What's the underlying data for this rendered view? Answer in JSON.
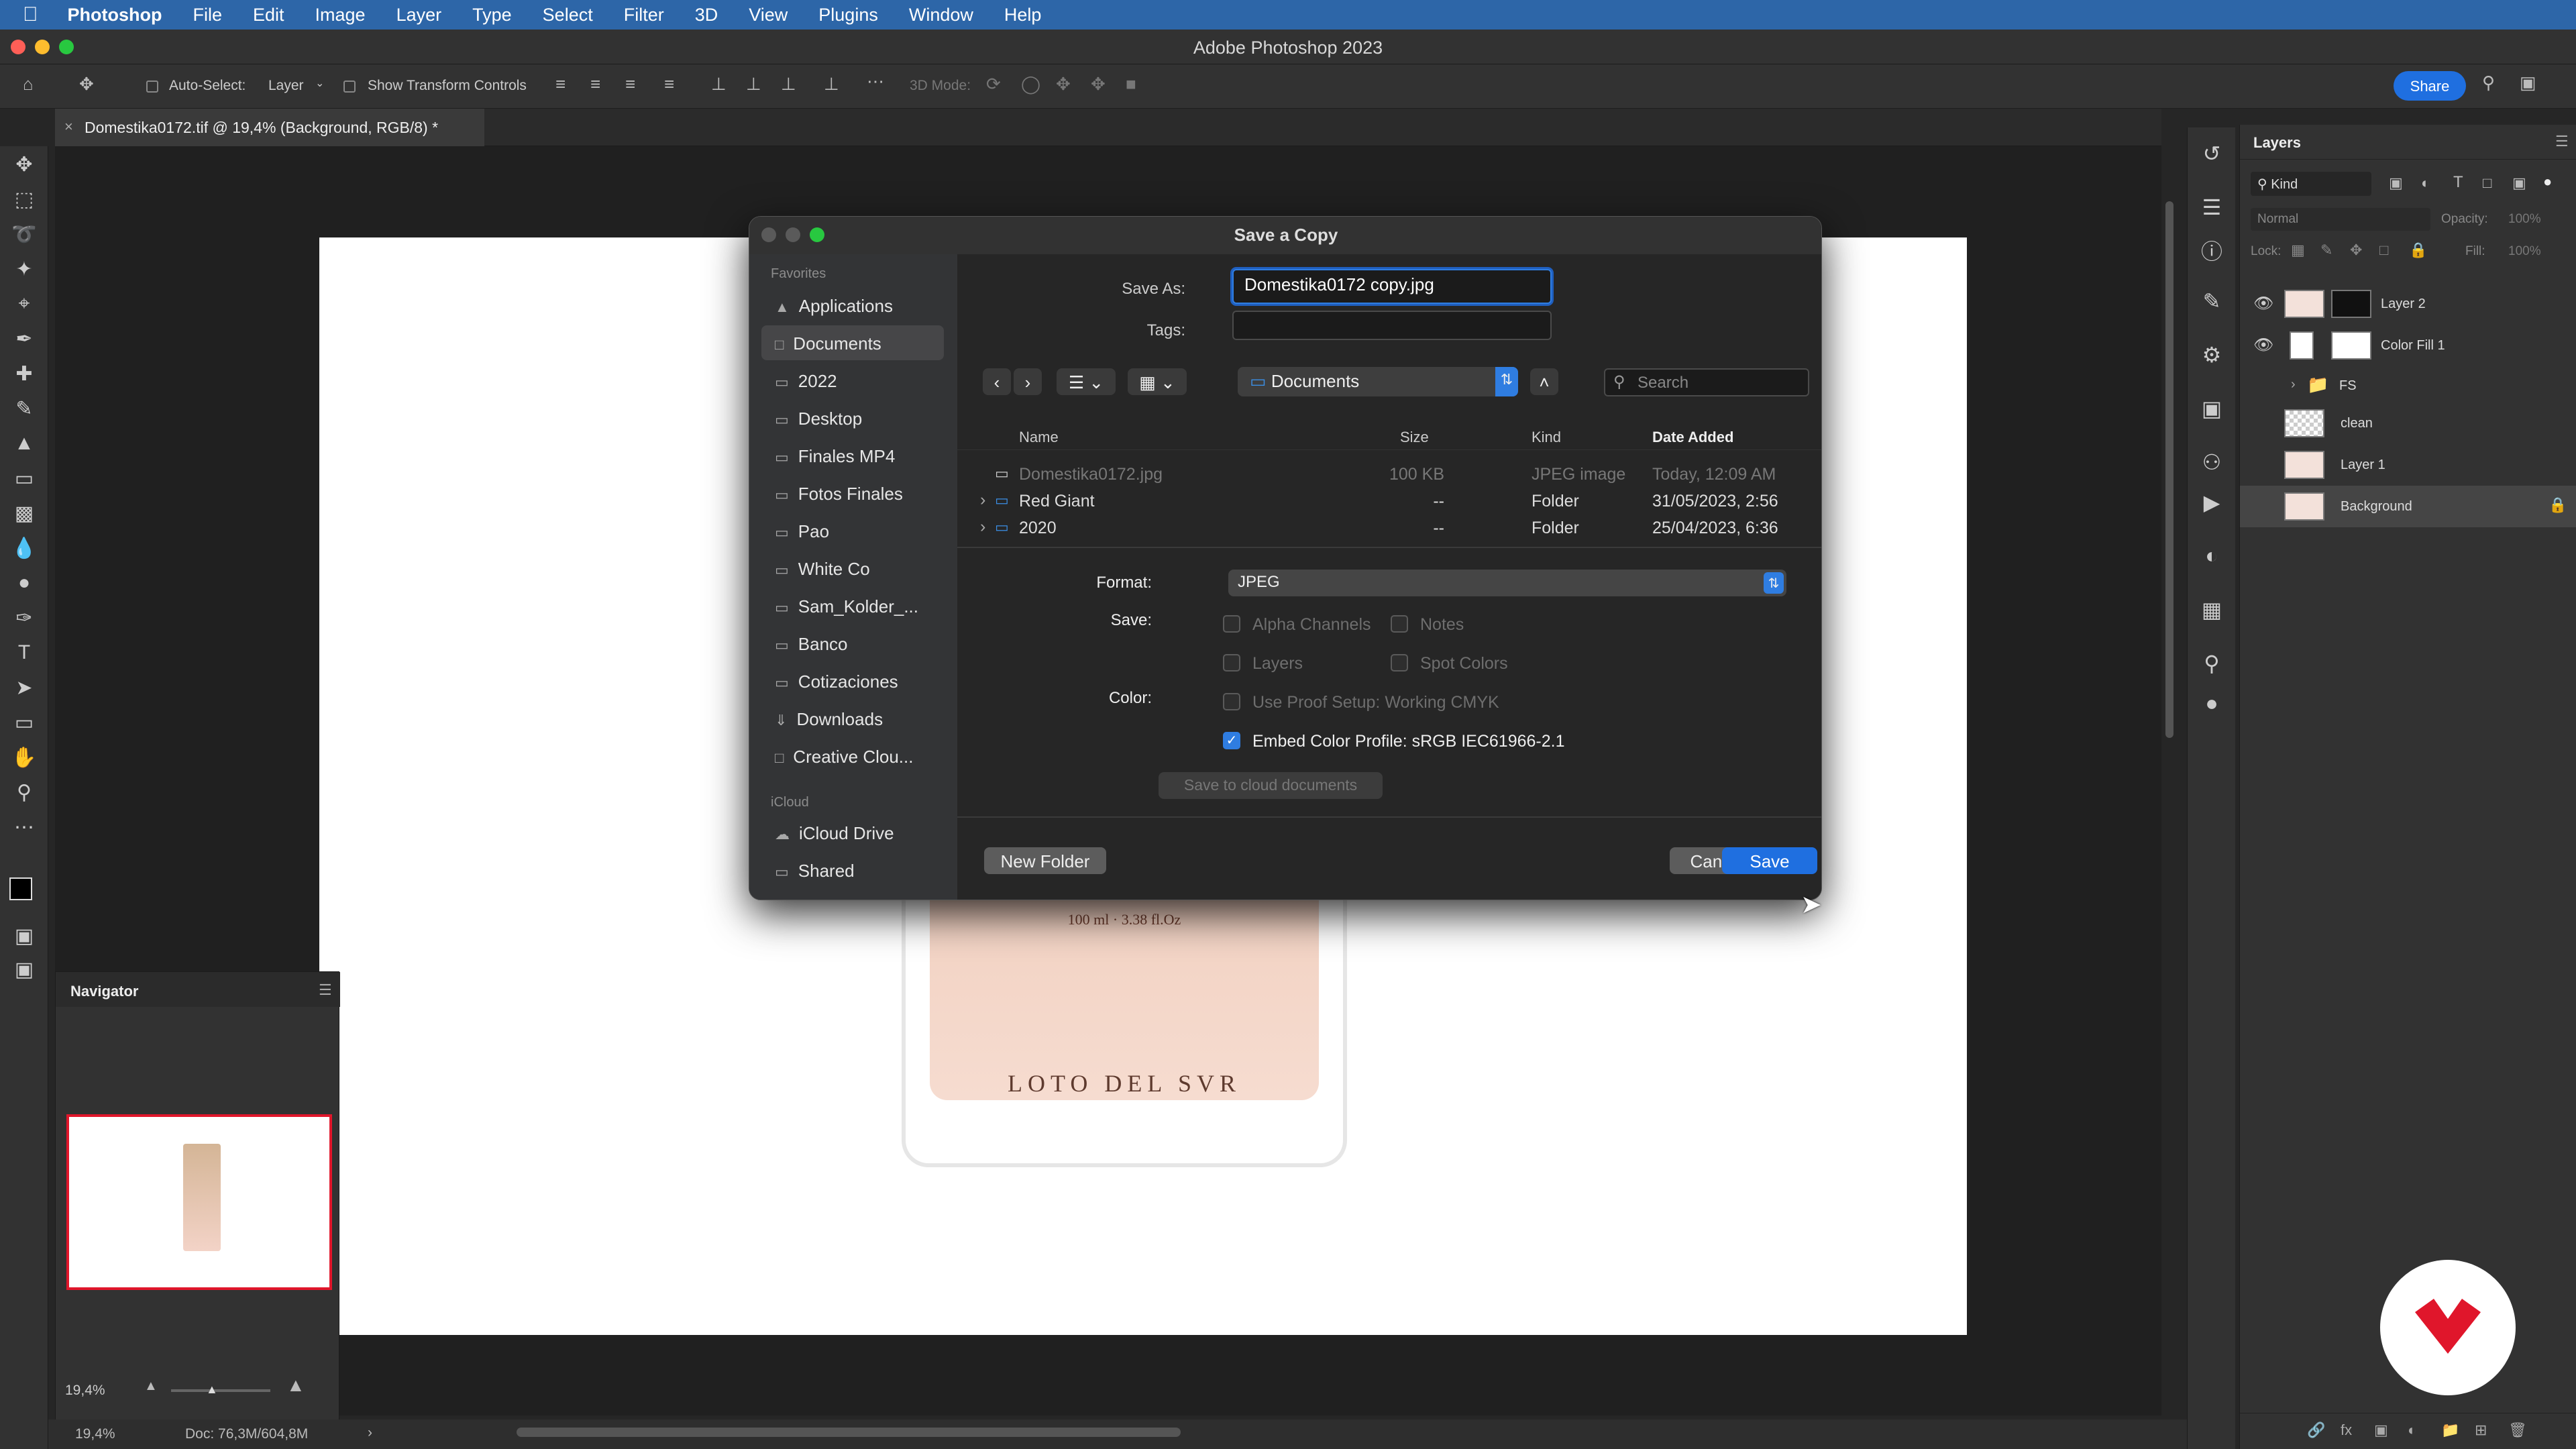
{
  "menubar": {
    "app": "Photoshop",
    "items": [
      "File",
      "Edit",
      "Image",
      "Layer",
      "Type",
      "Select",
      "Filter",
      "3D",
      "View",
      "Plugins",
      "Window",
      "Help"
    ]
  },
  "window": {
    "title": "Adobe Photoshop 2023"
  },
  "options_bar": {
    "auto_select_label": "Auto-Select:",
    "auto_select_value": "Layer",
    "show_transform_label": "Show Transform Controls",
    "mode_3d_label": "3D Mode:",
    "share_label": "Share"
  },
  "document_tab": {
    "title": "Domestika0172.tif @ 19,4% (Background, RGB/8) *"
  },
  "canvas": {
    "bottle_text": "100 ml · 3.38 fl.Oz",
    "brand_text": "LOTO DEL SVR"
  },
  "layers_panel": {
    "title": "Layers",
    "filter_kind": "Kind",
    "blend_mode": "Normal",
    "opacity_label": "Opacity:",
    "opacity_value": "100%",
    "lock_label": "Lock:",
    "fill_label": "Fill:",
    "fill_value": "100%",
    "layers": [
      {
        "name": "Layer 2",
        "visible": true
      },
      {
        "name": "Color Fill 1",
        "visible": true
      },
      {
        "name": "FS",
        "visible": false
      },
      {
        "name": "clean",
        "visible": false
      },
      {
        "name": "Layer 1",
        "visible": false
      },
      {
        "name": "Background",
        "visible": false
      }
    ]
  },
  "navigator": {
    "title": "Navigator",
    "zoom": "19,4%"
  },
  "status_bar": {
    "zoom": "19,4%",
    "doc": "Doc: 76,3M/604,8M"
  },
  "dialog": {
    "title": "Save a Copy",
    "save_as_label": "Save As:",
    "save_as_value": "Domestika0172 copy.jpg",
    "tags_label": "Tags:",
    "location": "Documents",
    "search_placeholder": "Search",
    "favorites_label": "Favorites",
    "icloud_label": "iCloud",
    "sidebar": [
      "Applications",
      "Documents",
      "2022",
      "Desktop",
      "Finales MP4",
      "Fotos Finales",
      "Pao",
      "White Co",
      "Sam_Kolder_...",
      "Banco",
      "Cotizaciones",
      "Downloads",
      "Creative Clou..."
    ],
    "icloud_items": [
      "iCloud Drive",
      "Shared"
    ],
    "columns": {
      "name": "Name",
      "size": "Size",
      "kind": "Kind",
      "date": "Date Added"
    },
    "files": [
      {
        "name": "Domestika0172.jpg",
        "size": "100 KB",
        "kind": "JPEG image",
        "date": "Today, 12:09 AM"
      },
      {
        "name": "Red Giant",
        "size": "--",
        "kind": "Folder",
        "date": "31/05/2023, 2:56"
      },
      {
        "name": "2020",
        "size": "--",
        "kind": "Folder",
        "date": "25/04/2023, 6:36"
      }
    ],
    "format_label": "Format:",
    "format_value": "JPEG",
    "save_label": "Save:",
    "opt_alpha": "Alpha Channels",
    "opt_notes": "Notes",
    "opt_layers": "Layers",
    "opt_spot": "Spot Colors",
    "color_label": "Color:",
    "opt_proof": "Use Proof Setup:  Working CMYK",
    "opt_embed": "Embed Color Profile:  sRGB IEC61966-2.1",
    "cloud_button": "Save to cloud documents",
    "new_folder": "New Folder",
    "cancel": "Cancel",
    "save": "Save"
  },
  "colors": {
    "accent": "#1f6fe0",
    "menubar": "#2d66a8",
    "logo": "#e0162b"
  }
}
